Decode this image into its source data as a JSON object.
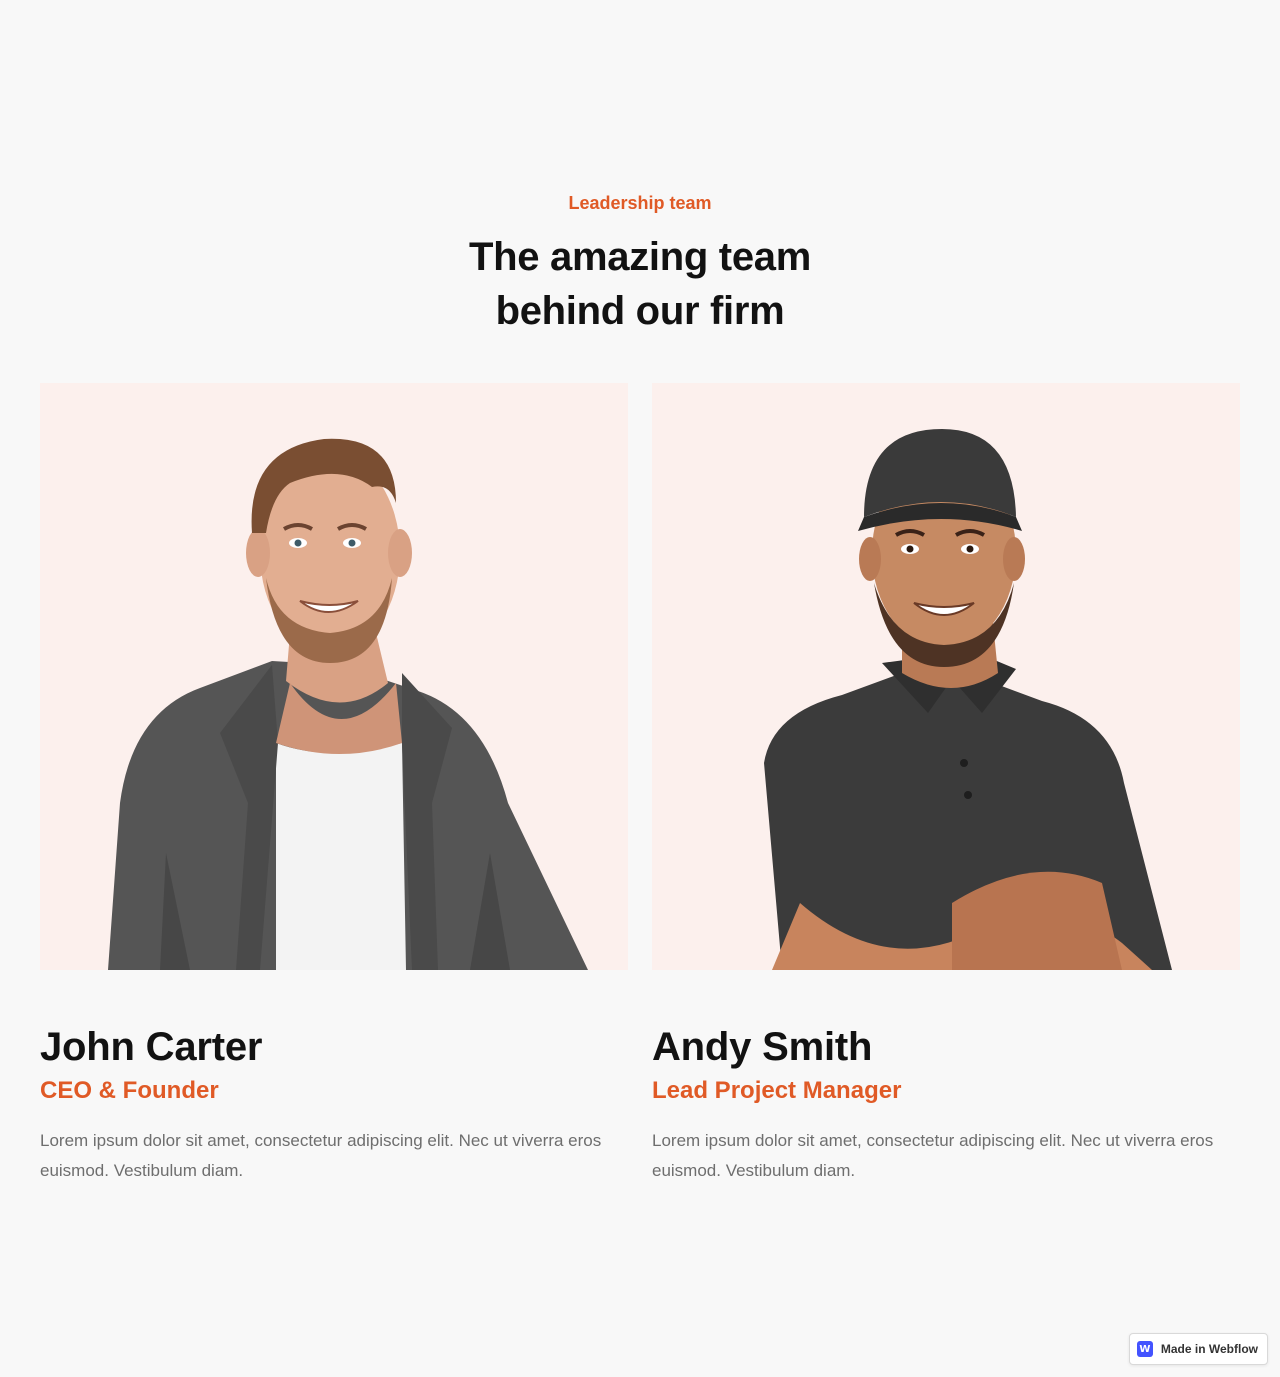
{
  "section": {
    "eyebrow": "Leadership team",
    "heading_line1": "The amazing team",
    "heading_line2": "behind our firm"
  },
  "team": [
    {
      "name": "John Carter",
      "role": "CEO & Founder",
      "bio": "Lorem ipsum dolor sit amet, consectetur adipiscing elit. Nec ut viverra eros euismod. Vestibulum diam."
    },
    {
      "name": "Andy Smith",
      "role": "Lead Project Manager",
      "bio": "Lorem ipsum dolor sit amet, consectetur adipiscing elit. Nec ut viverra eros euismod. Vestibulum diam."
    }
  ],
  "badge": {
    "logo_letter": "W",
    "label": "Made in Webflow",
    "icon": "webflow-logo-icon"
  },
  "colors": {
    "accent": "#e05a26",
    "background": "#f8f8f8",
    "photo_background": "#fcf0ed",
    "heading": "#121212",
    "body_text": "#6e6e6e"
  }
}
